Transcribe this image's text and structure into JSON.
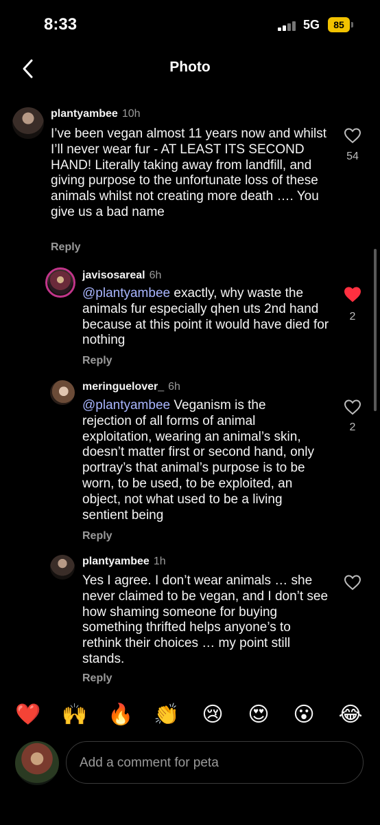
{
  "status_bar": {
    "time": "8:33",
    "network": "5G",
    "battery": "85"
  },
  "nav": {
    "title": "Photo"
  },
  "comments": [
    {
      "username": "plantyambee",
      "time": "10h",
      "text": "I’ve been vegan almost 11 years now and whilst I’ll never wear fur - AT LEAST ITS SECOND HAND! Literally taking away from landfill, and giving purpose to the unfortunate loss of these animals whilst not creating more death …. You give us a bad name",
      "likes": "54",
      "liked": false,
      "reply_label": "Reply"
    },
    {
      "username": "javisosareal",
      "time": "6h",
      "mention": "@plantyambee",
      "text": " exactly, why waste the animals fur especially qhen uts 2nd hand because at this point it would have died for nothing",
      "likes": "2",
      "liked": true,
      "reply_label": "Reply"
    },
    {
      "username": "meringuelover_",
      "time": "6h",
      "mention": "@plantyambee",
      "text": " Veganism is the rejection of all forms of animal exploitation, wearing an animal’s skin, doesn’t matter first or second hand, only portray’s that animal’s purpose is to be worn, to be used, to be exploited, an object, not what used to be a living sentient being",
      "likes": "2",
      "liked": false,
      "reply_label": "Reply"
    },
    {
      "username": "plantyambee",
      "time": "1h",
      "text": "Yes I agree. I don’t wear animals … she never claimed to be vegan, and I don’t see how shaming someone for buying something thrifted helps anyone’s to rethink their choices … my point still stands.",
      "likes": "",
      "liked": false,
      "reply_label": "Reply"
    }
  ],
  "reactions": [
    "❤️",
    "🙌",
    "🔥",
    "👏",
    "😢",
    "😍",
    "😮",
    "😂"
  ],
  "composer": {
    "placeholder": "Add a comment for peta"
  },
  "colors": {
    "background": "#000000",
    "like_active": "#ff3040",
    "mention": "#a9b6ff",
    "battery": "#f2c200"
  }
}
